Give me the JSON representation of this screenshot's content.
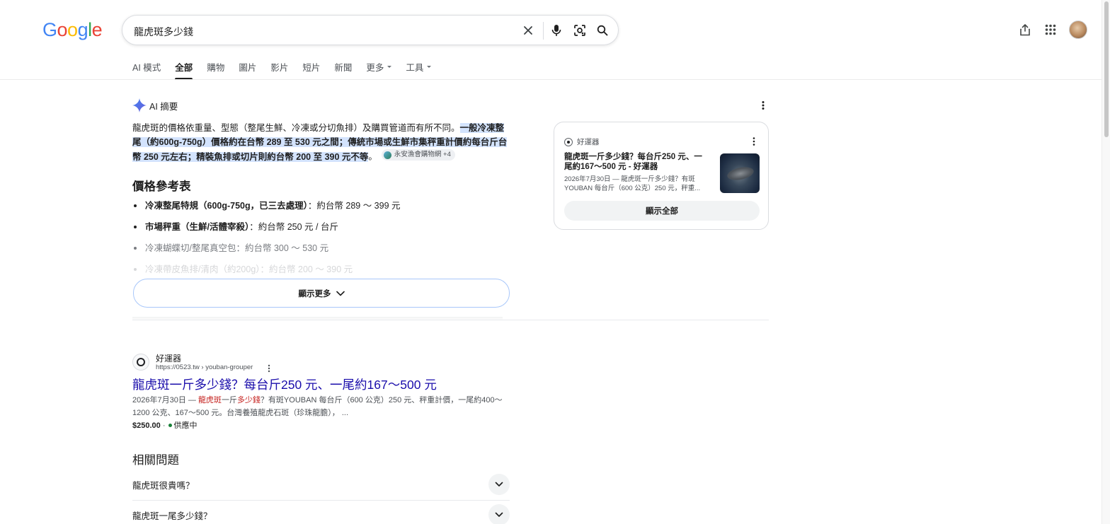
{
  "logo": {
    "letters": [
      "G",
      "o",
      "o",
      "g",
      "l",
      "e"
    ],
    "colors": [
      "#4285F4",
      "#EA4335",
      "#FBBC05",
      "#4285F4",
      "#34A853",
      "#EA4335"
    ]
  },
  "search": {
    "query": "龍虎斑多少錢"
  },
  "tabs": [
    {
      "label": "AI 模式",
      "active": false,
      "dropdown": false
    },
    {
      "label": "全部",
      "active": true,
      "dropdown": false
    },
    {
      "label": "購物",
      "active": false,
      "dropdown": false
    },
    {
      "label": "圖片",
      "active": false,
      "dropdown": false
    },
    {
      "label": "影片",
      "active": false,
      "dropdown": false
    },
    {
      "label": "短片",
      "active": false,
      "dropdown": false
    },
    {
      "label": "新聞",
      "active": false,
      "dropdown": false
    },
    {
      "label": "更多",
      "active": false,
      "dropdown": true
    },
    {
      "label": "工具",
      "active": false,
      "dropdown": true
    }
  ],
  "ai_overview": {
    "label": "AI 摘要",
    "intro": "龍虎斑的價格依重量、型態（整尾生鮮、冷凍或分切魚排）及購買管道而有所不同。",
    "highlight": "一般冷凍整尾（約600g-750g）價格約在台幣 289 至 530 元之間；傳統市場或生鮮市集秤重計價約每台斤台幣 250 元左右；精裝魚排或切片則約台幣 200 至 390 元不等",
    "end": "。",
    "chip": "永安漁會購物網 +4",
    "price_title": "價格參考表",
    "prices": [
      {
        "bold": "冷凍整尾特規（600g-750g，已三去處理）",
        "rest": "：約台幣 289 ～ 399 元"
      },
      {
        "bold": "市場秤重（生鮮/活體宰殺）",
        "rest": "：約台幣 250 元 / 台斤"
      },
      {
        "bold": "",
        "rest": "冷凍蝴蝶切/整尾真空包：約台幣 300 ～ 530 元"
      },
      {
        "bold": "",
        "rest": "冷凍帶皮魚排/清肉（約200g）：約台幣 200 ～ 390 元"
      }
    ],
    "show_more": "顯示更多"
  },
  "source_card": {
    "site": "好運器",
    "title": "龍虎斑一斤多少錢？每台斤250 元、一尾約167～500 元 - 好運器",
    "snippet": "2026年7月30日 — 龍虎斑一斤多少錢？有斑YOUBAN 每台斤（600 公克）250 元，秤重...",
    "show_all": "顯示全部"
  },
  "result": {
    "site": "好運器",
    "url": "https://0523.tw › youban-grouper",
    "title": "龍虎斑一斤多少錢？每台斤250 元、一尾約167～500 元",
    "snippet_date": "2026年7月30日 — ",
    "snippet_kw1": "龍虎斑",
    "snippet_mid": "一斤",
    "snippet_kw2": "多少錢",
    "snippet_rest": "？有斑YOUBAN 每台斤（600 公克）250 元、秤重計價，一尾約400～1200 公克、167～500 元。台灣養殖龍虎石斑（珍珠龍膽）， ...",
    "price": "$250.00",
    "separator": "·",
    "availability": "供應中"
  },
  "related": {
    "title": "相關問題",
    "questions": [
      "龍虎斑很貴嗎？",
      "龍虎斑一尾多少錢？"
    ]
  }
}
